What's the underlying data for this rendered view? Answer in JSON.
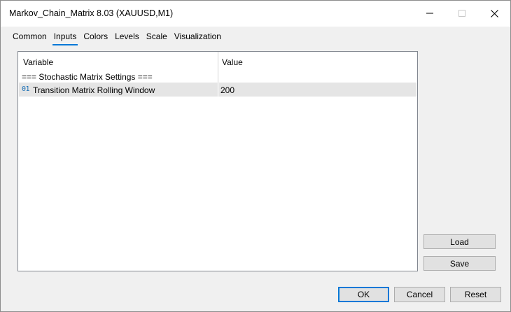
{
  "window": {
    "title": "Markov_Chain_Matrix 8.03 (XAUUSD,M1)"
  },
  "titlebar_icons": {
    "minimize": "minimize-icon",
    "maximize": "maximize-icon",
    "close": "close-icon"
  },
  "tabs": [
    {
      "label": "Common",
      "active": false
    },
    {
      "label": "Inputs",
      "active": true
    },
    {
      "label": "Colors",
      "active": false
    },
    {
      "label": "Levels",
      "active": false
    },
    {
      "label": "Scale",
      "active": false
    },
    {
      "label": "Visualization",
      "active": false
    }
  ],
  "inputs_table": {
    "columns": [
      "Variable",
      "Value"
    ],
    "section_header": "=== Stochastic Matrix Settings ===",
    "rows": [
      {
        "type_icon": "01",
        "variable": "Transition Matrix Rolling Window",
        "value": "200"
      }
    ]
  },
  "side_buttons": {
    "load": "Load",
    "save": "Save"
  },
  "footer_buttons": {
    "ok": "OK",
    "cancel": "Cancel",
    "reset": "Reset"
  },
  "colors": {
    "accent": "#0078d7",
    "selected_row": "#e5e5e5",
    "int_icon": "#1a6fb5"
  }
}
